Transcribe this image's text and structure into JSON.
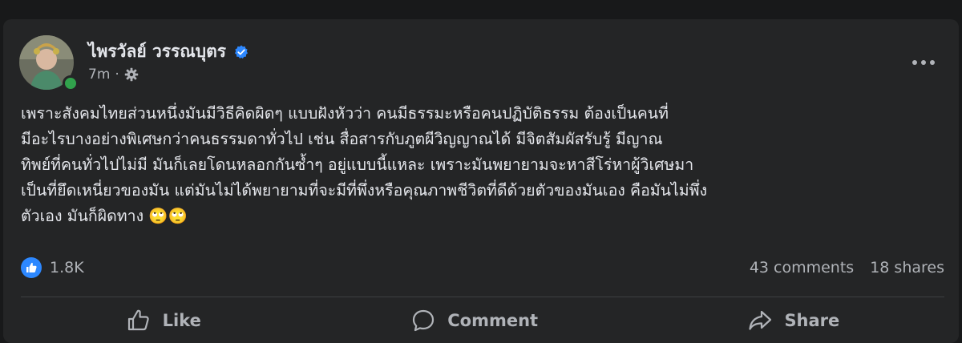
{
  "post": {
    "author": "ไพรวัลย์ วรรณบุตร",
    "time": "7m",
    "separator": "·",
    "text_lines": [
      "เพราะสังคมไทยส่วนหนึ่งมันมีวิธีคิดผิดๆ แบบฝังหัวว่า คนมีธรรมะหรือคนปฏิบัติธรรม ต้องเป็นคนที่",
      "มีอะไรบางอย่างพิเศษกว่าคนธรรมดาทั่วไป เช่น สื่อสารกับภูตผีวิญญาณได้ มีจิตสัมผัสรับรู้ มีญาณ",
      "ทิพย์ที่คนทั่วไปไม่มี มันก็เลยโดนหลอกกันซ้ำๆ อยู่แบบนี้แหละ เพราะมันพยายามจะหาสีโร่หาผู้วิเศษมา",
      "เป็นที่ยึดเหนี่ยวของมัน แต่มันไม่ได้พยายามที่จะมีที่พึ่งหรือคุณภาพชีวิตที่ดีด้วยตัวของมันเอง คือมันไม่พึ่ง",
      "ตัวเอง มันก็ผิดทาง 🙄🙄"
    ]
  },
  "stats": {
    "reactions_count": "1.8K",
    "comments": "43 comments",
    "shares": "18 shares"
  },
  "actions": {
    "like": "Like",
    "comment": "Comment",
    "share": "Share"
  },
  "colors": {
    "background": "#18191a",
    "card": "#242526",
    "text_primary": "#e4e6eb",
    "text_secondary": "#b0b3b8",
    "accent_blue": "#2d88ff",
    "online_green": "#31a24c"
  },
  "icons": {
    "verified": "verified-badge-icon",
    "audience": "gear-icon",
    "more": "more-options-icon",
    "like_reaction": "thumbs-up-icon",
    "like_action": "thumbs-up-outline-icon",
    "comment_action": "speech-bubble-icon",
    "share_action": "share-arrow-icon"
  }
}
